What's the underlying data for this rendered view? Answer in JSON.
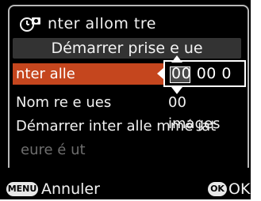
{
  "header": {
    "title": "nter allom tre",
    "icon": "self-timer-icon"
  },
  "start_bar": {
    "label": "Démarrer prise   e   ue"
  },
  "menu": {
    "interval": {
      "label": "nter alle",
      "value": "00 00 0"
    },
    "shots": {
      "label": "Nom re   e   ues",
      "value": "00  images"
    },
    "start_immediately": {
      "label": "Démarrer inter alle   mmé iat"
    },
    "start_time": {
      "label": "eure   é  ut"
    }
  },
  "footer": {
    "menu_badge": "MENU",
    "cancel_label": "Annuler",
    "ok_badge": "OK",
    "ok_label": "OK"
  },
  "colors": {
    "selection": "#c5461e",
    "background": "#000000",
    "start_bar": "#333333",
    "disabled_text": "#6e6e6e"
  }
}
